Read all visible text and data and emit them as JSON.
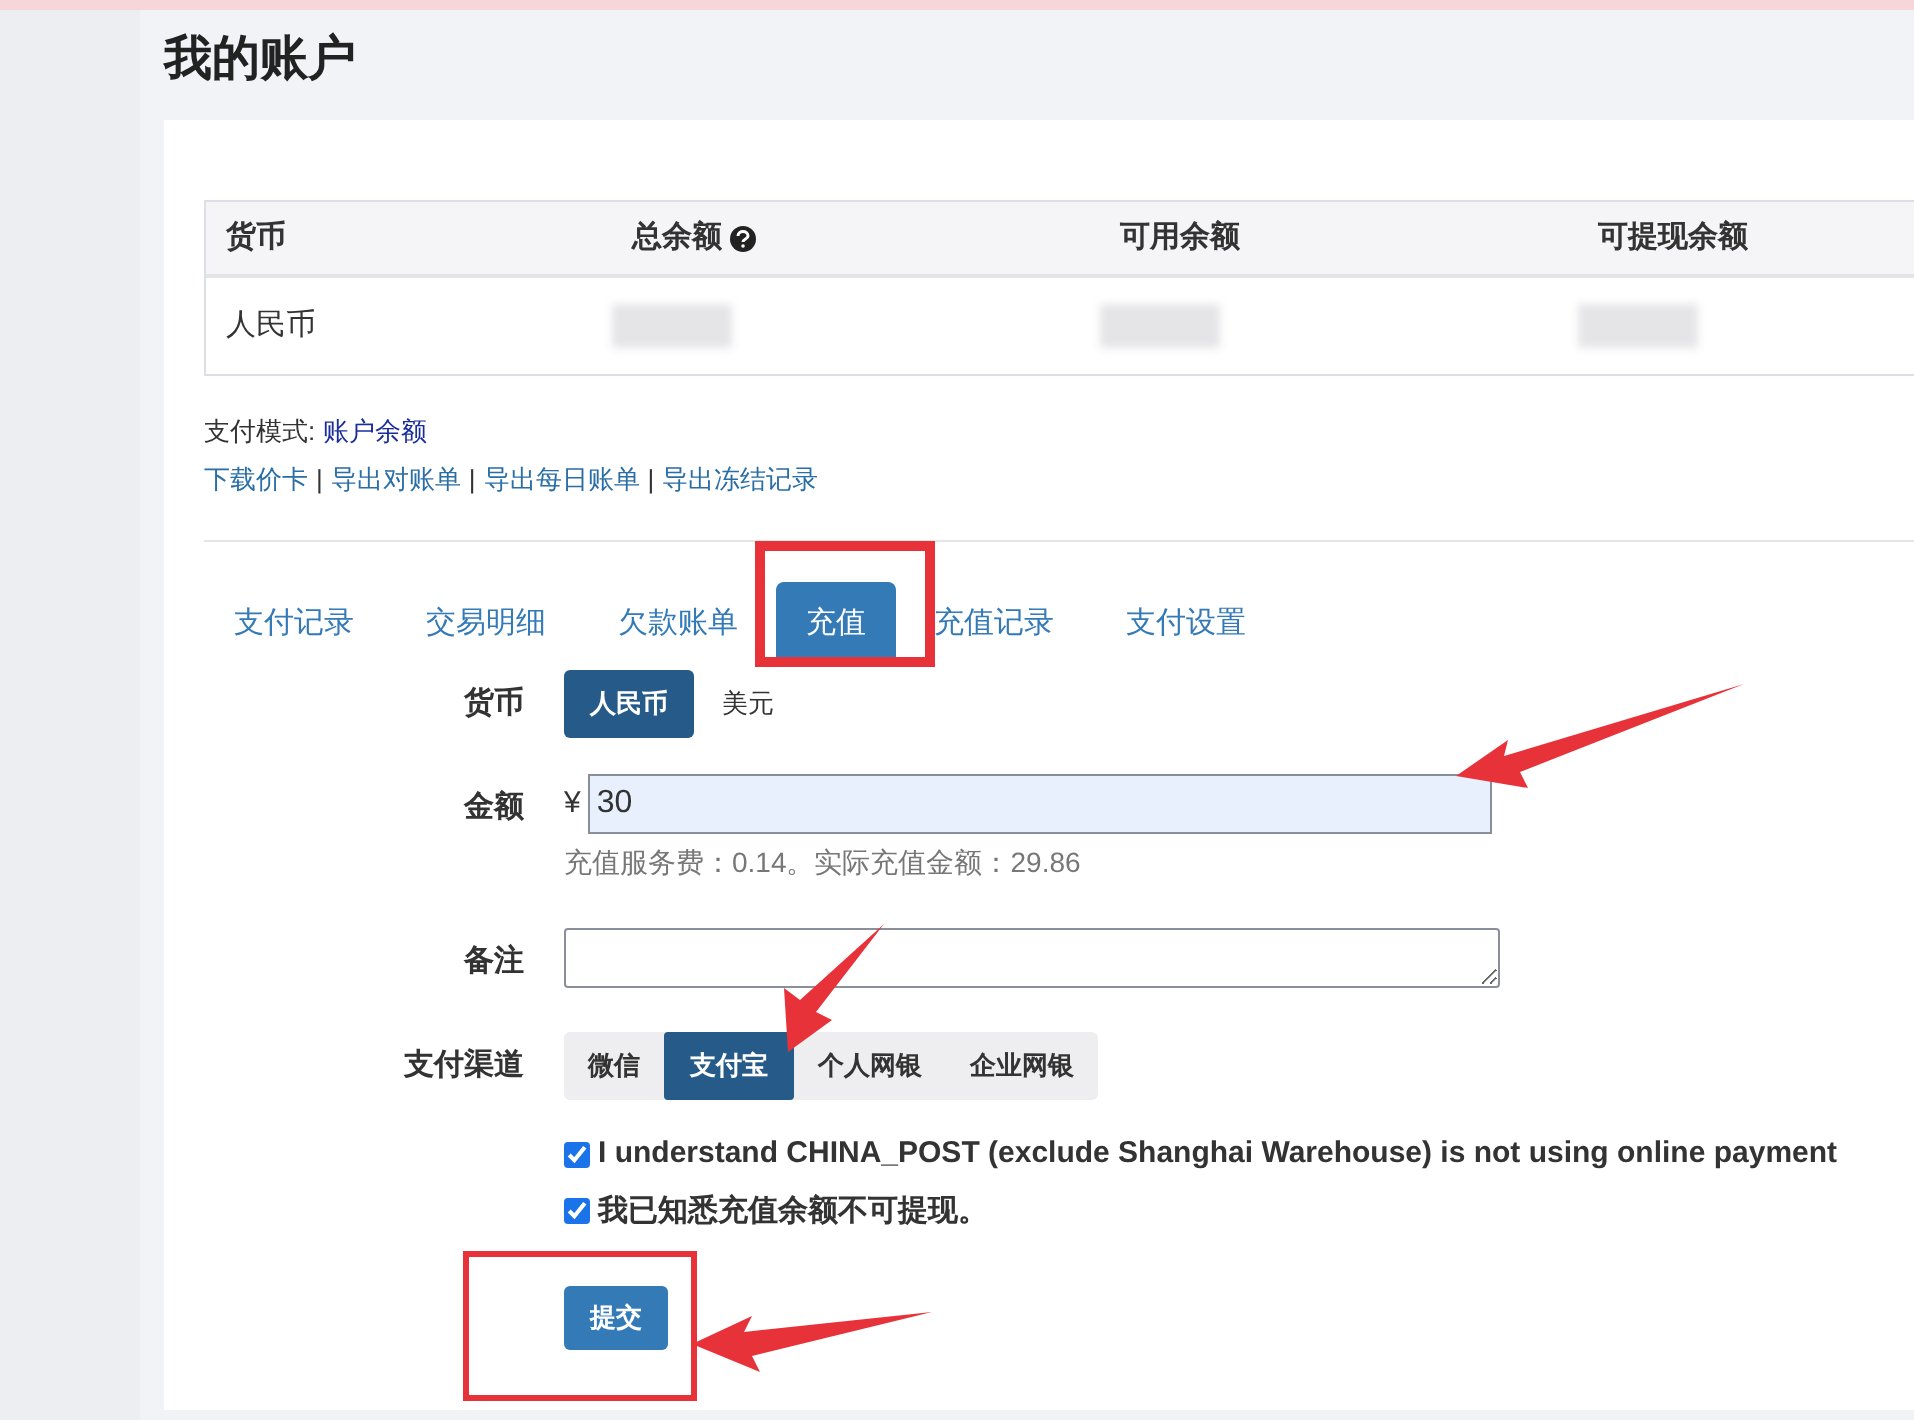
{
  "page_title": "我的账户",
  "balance_table": {
    "columns": [
      "货币",
      "总余额",
      "可用余额",
      "可提现余额"
    ],
    "rows": [
      {
        "currency": "人民币"
      }
    ]
  },
  "payment_mode": {
    "label": "支付模式:",
    "value": "账户余额"
  },
  "export_links": {
    "items": [
      "下载价卡",
      "导出对账单",
      "导出每日账单",
      "导出冻结记录"
    ],
    "separator": "|"
  },
  "tabs": [
    {
      "label": "支付记录",
      "selected": false
    },
    {
      "label": "交易明细",
      "selected": false
    },
    {
      "label": "欠款账单",
      "selected": false
    },
    {
      "label": "充值",
      "selected": true
    },
    {
      "label": "充值记录",
      "selected": false
    },
    {
      "label": "支付设置",
      "selected": false
    }
  ],
  "form": {
    "currency": {
      "label": "货币",
      "options": [
        {
          "label": "人民币",
          "selected": true
        },
        {
          "label": "美元",
          "selected": false
        }
      ]
    },
    "amount": {
      "label": "金额",
      "prefix": "¥",
      "value": "30",
      "hint": "充值服务费：0.14。实际充值金额：29.86"
    },
    "note": {
      "label": "备注"
    },
    "channel": {
      "label": "支付渠道",
      "options": [
        {
          "label": "微信",
          "selected": false
        },
        {
          "label": "支付宝",
          "selected": true
        },
        {
          "label": "个人网银",
          "selected": false
        },
        {
          "label": "企业网银",
          "selected": false
        }
      ]
    },
    "agreements": [
      {
        "text": "I understand CHINA_POST (exclude Shanghai Warehouse) is not using online payment",
        "checked": true
      },
      {
        "text": "我已知悉充值余额不可提现。",
        "checked": true
      }
    ],
    "submit": "提交"
  }
}
